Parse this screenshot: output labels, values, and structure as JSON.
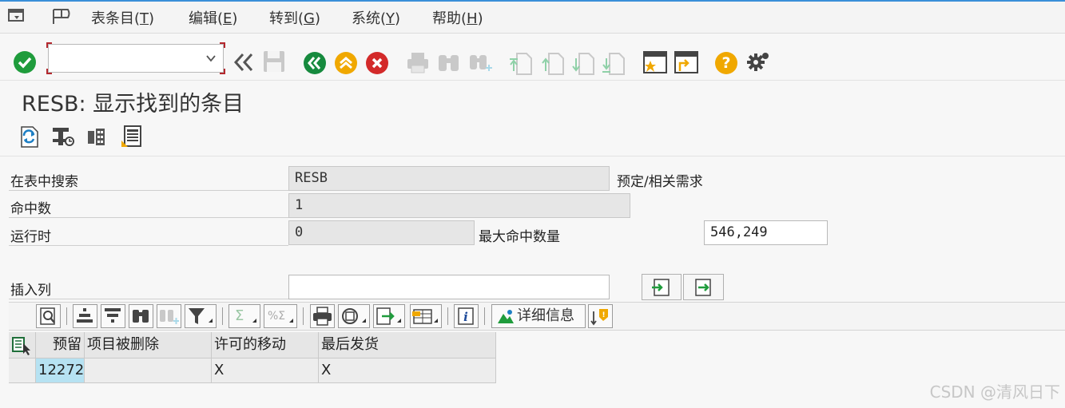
{
  "menu": {
    "items": [
      {
        "label": "表条目",
        "key": "T"
      },
      {
        "label": "编辑",
        "key": "E"
      },
      {
        "label": "转到",
        "key": "G"
      },
      {
        "label": "系统",
        "key": "Y"
      },
      {
        "label": "帮助",
        "key": "H"
      }
    ]
  },
  "toolbar": {
    "command_value": "",
    "icons": [
      "enter-icon",
      "back-double-icon",
      "save-icon",
      "back-icon",
      "exit-icon",
      "cancel-icon",
      "print-icon",
      "find-icon",
      "find-next-icon",
      "first-page-icon",
      "prev-page-icon",
      "next-page-icon",
      "last-page-icon",
      "create-session-icon",
      "shortcut-icon",
      "help-icon",
      "settings-gear-icon"
    ]
  },
  "title": "RESB: 显示找到的条目",
  "form": {
    "search_table_label": "在表中搜索",
    "search_table_value": "RESB",
    "search_table_desc": "预定/相关需求",
    "hits_label": "命中数",
    "hits_value": "1",
    "runtime_label": "运行时",
    "runtime_value": "0",
    "max_hits_label": "最大命中数量",
    "max_hits_value": "546,249",
    "insert_col_label": "插入列",
    "insert_col_value": ""
  },
  "alv_toolbar": {
    "details_label": "详细信息",
    "info_label": "i",
    "sum_label": "Σ",
    "subtotal_label": "%Σ"
  },
  "table": {
    "headers": [
      "预留",
      "项目被删除",
      "许可的移动",
      "最后发货"
    ],
    "rows": [
      [
        "12272",
        "",
        "X",
        "X"
      ]
    ]
  },
  "watermark": "CSDN @清风日下",
  "colors": {
    "ok_green": "#1f9c3c",
    "nav_green": "#168a3e",
    "yellow": "#f0a800",
    "red": "#d32a2a",
    "selected_cell": "#b6e2f2"
  }
}
